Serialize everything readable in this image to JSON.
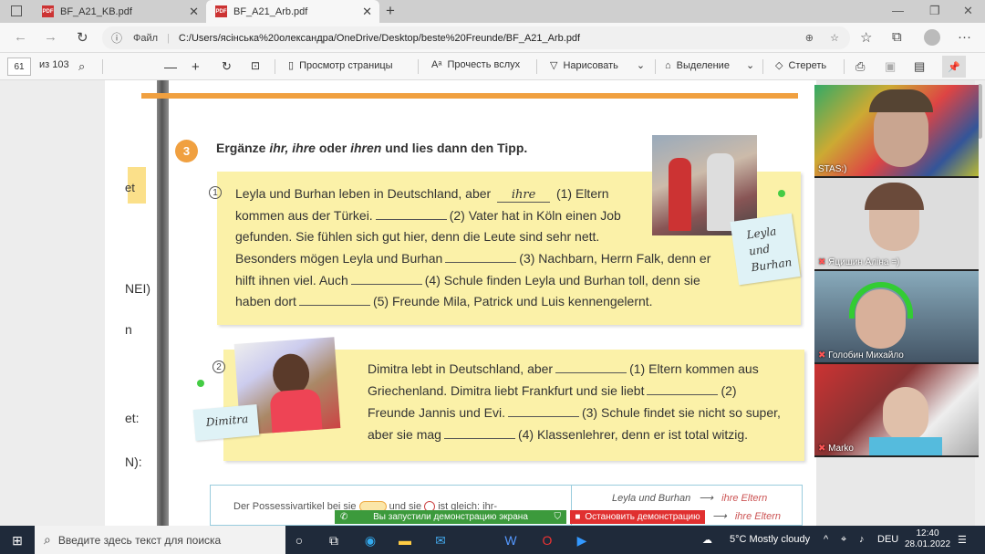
{
  "browser": {
    "tabs": [
      {
        "label": "BF_A21_KB.pdf",
        "active": false
      },
      {
        "label": "BF_A21_Arb.pdf",
        "active": true
      }
    ],
    "new_tab": "+",
    "address": {
      "scheme_label": "Файл",
      "url": "C:/Users/ясінська%20олександра/OneDrive/Desktop/beste%20Freunde/BF_A21_Arb.pdf"
    }
  },
  "pdf_toolbar": {
    "page_value": "61",
    "page_total": "из 103",
    "view_label": "Просмотр страницы",
    "read_label": "Прочесть вслух",
    "draw_label": "Нарисовать",
    "highlight_label": "Выделение",
    "erase_label": "Стереть"
  },
  "left_page": {
    "fragments": [
      "et",
      "NEI)",
      "n",
      "et:",
      "N):"
    ]
  },
  "exercise": {
    "number": "3",
    "heading_pre": "Ergänze",
    "heading_words": "ihr, ihre",
    "heading_mid": "oder",
    "heading_last": "ihren",
    "heading_post": "und lies dann den Tipp.",
    "item1": {
      "num": "1",
      "filled": "ihre",
      "lines": [
        "Leyla und Burhan leben in Deutschland, aber",
        "(1) Eltern",
        "kommen aus der Türkei.",
        "(2) Vater hat in Köln einen Job",
        "gefunden. Sie fühlen sich gut hier, denn die Leute sind sehr nett.",
        "Besonders mögen Leyla und Burhan",
        "(3) Nachbarn, Herrn Falk, denn er",
        "hilft ihnen viel. Auch",
        "(4) Schule finden Leyla und Burhan toll, denn sie",
        "haben dort",
        "(5) Freunde Mila, Patrick und Luis kennengelernt."
      ],
      "tag": [
        "Leyla",
        "und",
        "Burhan"
      ]
    },
    "item2": {
      "num": "2",
      "lines": [
        "Dimitra lebt in Deutschland, aber",
        "(1) Eltern kommen aus",
        "Griechenland. Dimitra liebt Frankfurt und sie liebt",
        "(2)",
        "Freunde Jannis und Evi.",
        "(3) Schule findet sie nicht so super,",
        "aber sie mag",
        "(4) Klassenlehrer, denn er ist total witzig."
      ],
      "tag": "Dimitra"
    },
    "tip": {
      "text": "Der Possessivartikel bei sie",
      "text2": "und sie",
      "text3": "ist gleich: ihr-",
      "row1_left": "Leyla und Burhan",
      "row1_right": "ihre Eltern",
      "row2_right": "ihre Eltern"
    }
  },
  "participants": [
    {
      "name": "STAS:)"
    },
    {
      "name": "Яцишин Аліна =)"
    },
    {
      "name": "Голобин Михайло"
    },
    {
      "name": "Marko"
    }
  ],
  "screenshare": {
    "status": "Вы запустили демонстрацию экрана",
    "stop": "Остановить демонстрацию"
  },
  "taskbar": {
    "search_placeholder": "Введите здесь текст для поиска",
    "weather": "5°C  Mostly cloudy",
    "lang": "DEU",
    "time": "12:40",
    "date": "28.01.2022"
  }
}
